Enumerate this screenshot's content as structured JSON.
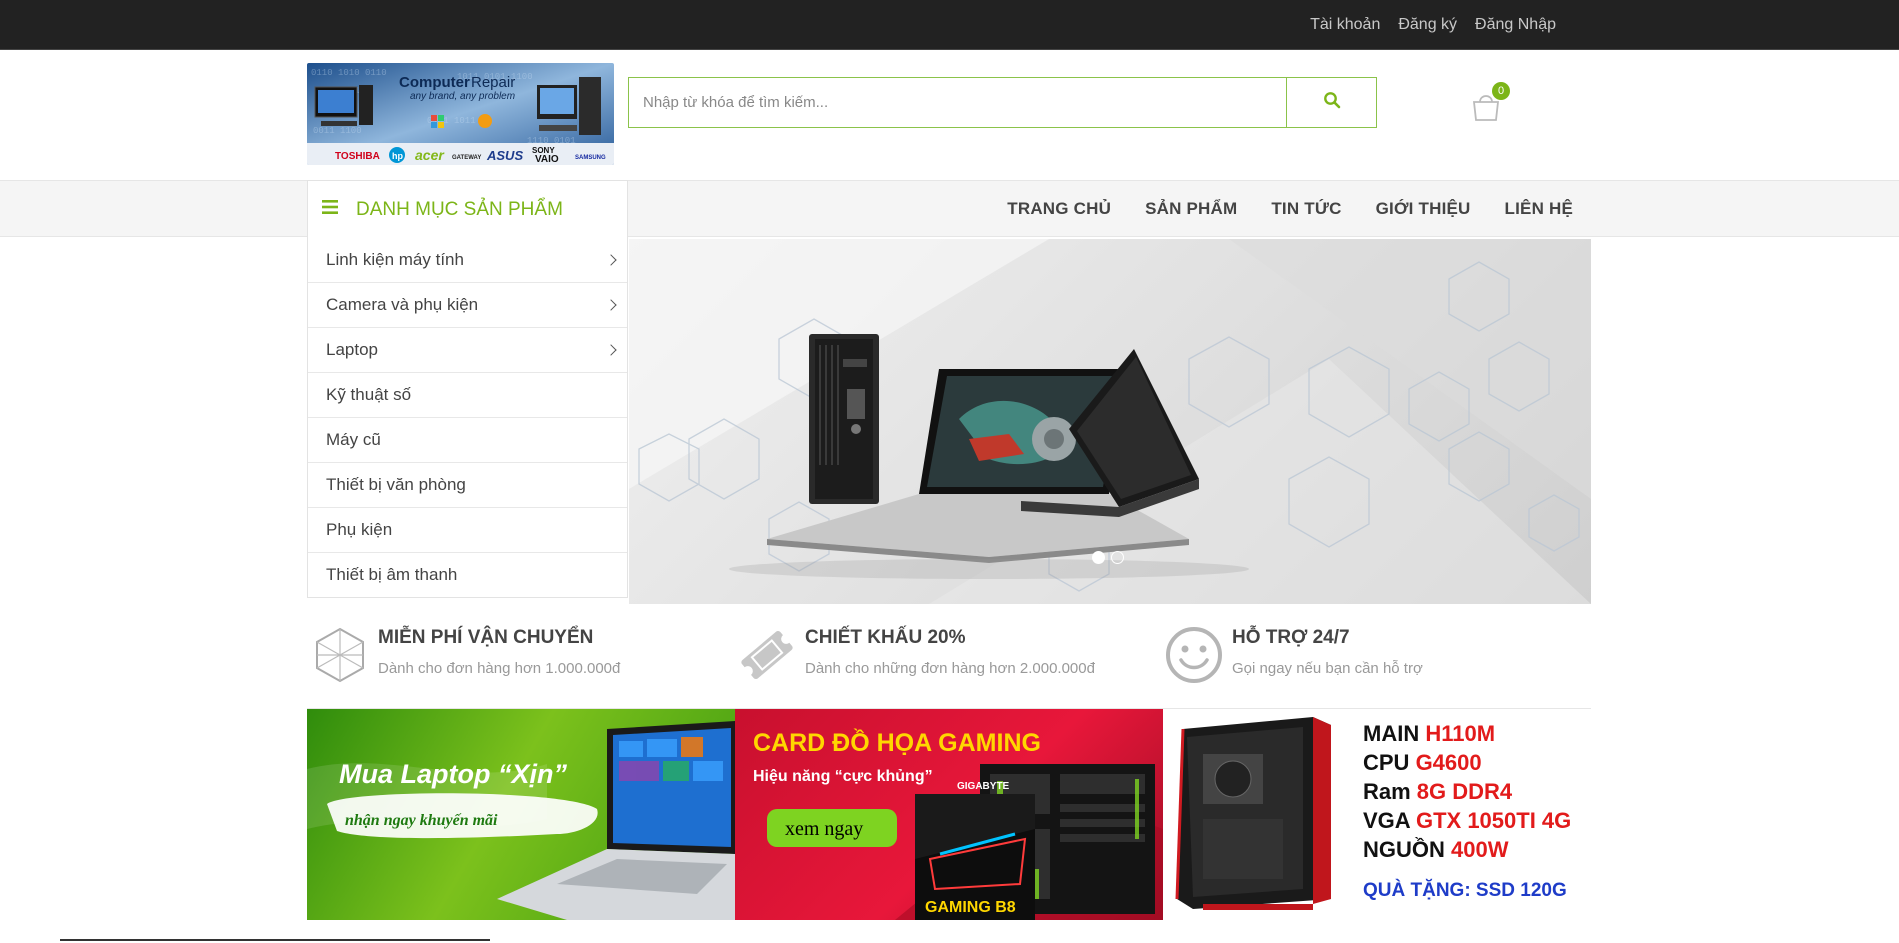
{
  "topbar": {
    "account": "Tài khoản",
    "register": "Đăng ký",
    "login": "Đăng Nhập"
  },
  "logo": {
    "title_bold": "Computer",
    "title_rest": " Repair",
    "tagline": "any brand, any problem",
    "brands": [
      "TOSHIBA",
      "hp",
      "acer",
      "GATEWAY",
      "ASUS",
      "SONY VAIO",
      "SAMSUNG"
    ]
  },
  "search": {
    "placeholder": "Nhập từ khóa để tìm kiếm...",
    "value": ""
  },
  "cart": {
    "count": "0"
  },
  "category_header": {
    "label": "DANH MỤC SẢN PHẨM"
  },
  "menu": [
    "TRANG CHỦ",
    "SẢN PHẨM",
    "TIN TỨC",
    "GIỚI THIỆU",
    "LIÊN HỆ"
  ],
  "categories": [
    {
      "label": "Linh kiện máy tính",
      "has_sub": true
    },
    {
      "label": "Camera và phụ kiện",
      "has_sub": true
    },
    {
      "label": "Laptop",
      "has_sub": true
    },
    {
      "label": "Kỹ thuật số",
      "has_sub": false
    },
    {
      "label": "Máy cũ",
      "has_sub": false
    },
    {
      "label": "Thiết bị văn phòng",
      "has_sub": false
    },
    {
      "label": "Phụ kiện",
      "has_sub": false
    },
    {
      "label": "Thiết bị âm thanh",
      "has_sub": false
    }
  ],
  "slider": {
    "slide_count": 2,
    "active_index": 0
  },
  "features": [
    {
      "icon": "shipping-diamond-icon",
      "title": "MIỄN PHÍ VẬN CHUYỂN",
      "sub": "Dành cho đơn hàng hơn 1.000.000đ"
    },
    {
      "icon": "ticket-icon",
      "title": "CHIẾT KHẤU 20%",
      "sub": "Dành cho những đơn hàng hơn 2.000.000đ"
    },
    {
      "icon": "smile-icon",
      "title": "HỖ TRỢ 24/7",
      "sub": "Gọi ngay nếu bạn cần hỗ trợ"
    }
  ],
  "banners": {
    "laptop": {
      "headline": "Mua Laptop “Xịn”",
      "cta": "nhận ngay khuyến mãi"
    },
    "gpu": {
      "headline": "CARD ĐỒ HỌA GAMING",
      "sub": "Hiệu năng “cực khủng”",
      "cta": "xem ngay",
      "box_text": "GAMING B8",
      "brand": "GIGABYTE"
    },
    "pc": {
      "specs": [
        {
          "k": "MAIN ",
          "v": "H110M"
        },
        {
          "k": "CPU ",
          "v": "G4600"
        },
        {
          "k": "Ram ",
          "v": "8G DDR4"
        },
        {
          "k": "VGA ",
          "v": "GTX 1050TI 4G"
        },
        {
          "k": "NGUỒN ",
          "v": "400W"
        }
      ],
      "gift": "QUÀ TẶNG: SSD 120G"
    }
  },
  "colors": {
    "accent": "#7cb518",
    "topbar": "#222222",
    "nav_bg": "#f5f5f5"
  }
}
